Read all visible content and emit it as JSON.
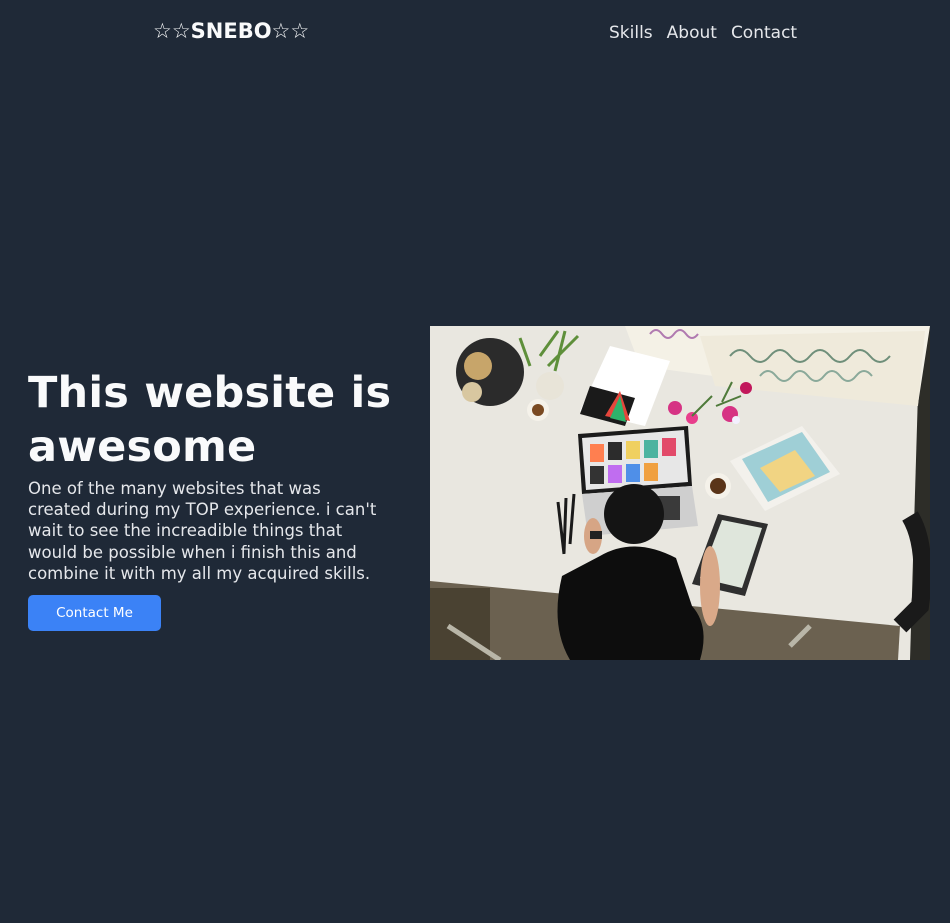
{
  "header": {
    "logo": "☆☆SNEBO☆☆",
    "nav": [
      {
        "label": "Skills"
      },
      {
        "label": "About"
      },
      {
        "label": "Contact"
      }
    ]
  },
  "hero": {
    "title": "This website is awesome",
    "description": "One of the many websites that was created during my TOP experience. i can't wait to see the increadible things that would be possible when i finish this and combine it with my all my acquired skills.",
    "button_label": "Contact Me"
  },
  "colors": {
    "background": "#1f2937",
    "accent": "#3b82f6",
    "text": "#f9fafb"
  }
}
